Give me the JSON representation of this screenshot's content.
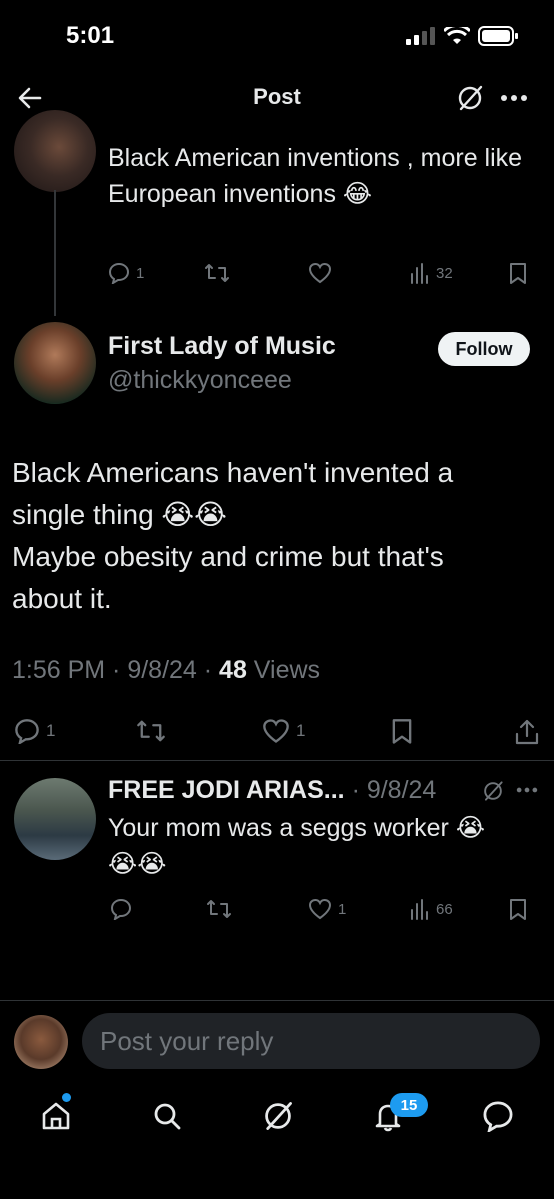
{
  "status_bar": {
    "time": "5:01"
  },
  "header": {
    "title": "Post"
  },
  "parent_post": {
    "text": "Black American inventions , more like European inventions 😂",
    "replies": "1",
    "views": "32"
  },
  "main_post": {
    "display_name": "First Lady of Music",
    "handle": "@thickkyonceee",
    "follow_label": "Follow",
    "line1": "Black Americans haven't invented a",
    "line2": "single thing 😭😭",
    "line3": "Maybe obesity and crime but that's",
    "line4": "about it.",
    "time": "1:56 PM · 9/8/24 · ",
    "views_count": "48",
    "views_label": " Views",
    "replies": "1",
    "likes": "1"
  },
  "reply_post": {
    "display_name": "FREE JODI ARIAS...",
    "date": "· 9/8/24",
    "line1": "Your mom was a seggs worker 😭",
    "line2": "😭😭",
    "likes": "1",
    "views": "66"
  },
  "composer": {
    "placeholder": "Post your reply"
  },
  "tab_bar": {
    "notifications_badge": "15"
  },
  "colors": {
    "accent": "#1d9bf0",
    "background": "#000000",
    "muted": "#71767b"
  }
}
